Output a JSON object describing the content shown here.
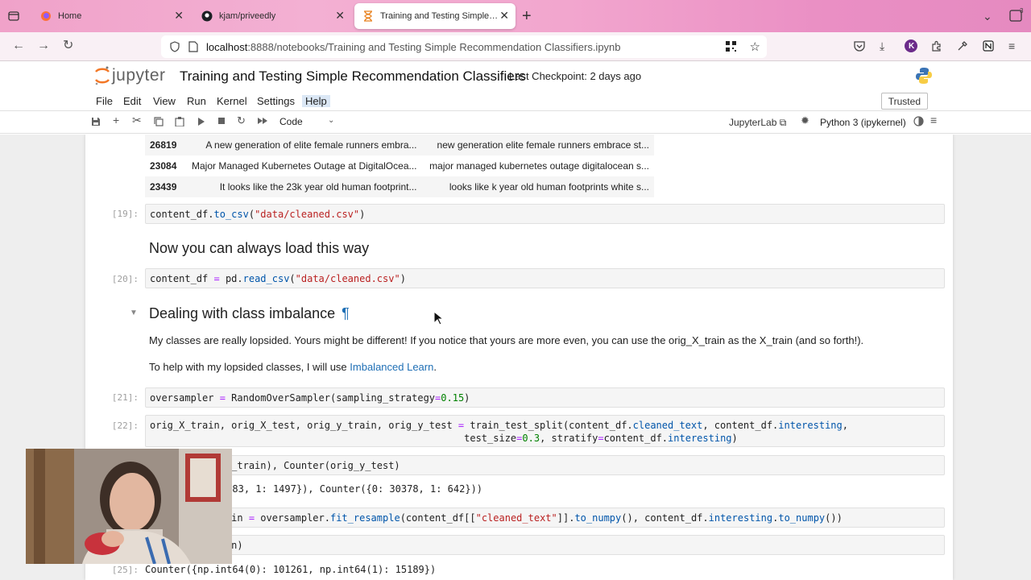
{
  "browser": {
    "tabs": [
      {
        "label": "Home",
        "active": false
      },
      {
        "label": "kjam/priveedly",
        "active": false
      },
      {
        "label": "Training and Testing Simple Rec",
        "active": true
      }
    ],
    "url_host": "localhost",
    "url_path": ":8888/notebooks/Training and Testing Simple Recommendation Classifiers.ipynb",
    "tabcount": "3",
    "profile_initial": "K"
  },
  "jupyter": {
    "logo_text": "jupyter",
    "notebook_title": "Training and Testing Simple Recommendation Classifiers",
    "checkpoint": "Last Checkpoint: 2 days ago",
    "menu": [
      "File",
      "Edit",
      "View",
      "Run",
      "Kernel",
      "Settings",
      "Help"
    ],
    "trusted": "Trusted",
    "cell_type": "Code",
    "jupyterlab_link": "JupyterLab",
    "kernel_name": "Python 3 (ipykernel)"
  },
  "dataframe_rows": [
    {
      "index": "26819",
      "col1": "A new generation of elite female runners embra...",
      "col2": "new generation elite female runners embrace st..."
    },
    {
      "index": "23084",
      "col1": "Major Managed Kubernetes Outage at DigitalOcea...",
      "col2": "major managed kubernetes outage digitalocean s..."
    },
    {
      "index": "23439",
      "col1": "It looks like the 23k year old human footprint...",
      "col2": "looks like k year old human footprints white s..."
    }
  ],
  "cells": {
    "c19_prompt": "[19]:",
    "c20_prompt": "[20]:",
    "c21_prompt": "[21]:",
    "c22_prompt": "[22]:",
    "c25_prompt": "[25]:",
    "md_heading1": "Now you can always load this way",
    "md_heading2": "Dealing with class imbalance",
    "md_para1": "My classes are really lopsided. Yours might be different! If you notice that yours are more even, you can use the orig_X_train as the X_train (and so forth!).",
    "md_para2_prefix": "To help with my lopsided classes, I will use ",
    "md_para2_link": "Imbalanced Learn",
    "md_para2_suffix": ".",
    "out_counter_partial": "0883, 1: 1497}), Counter({0: 30378, 1: 642}))",
    "out_25": "Counter({np.int64(0): 101261, np.int64(1): 15189})"
  }
}
